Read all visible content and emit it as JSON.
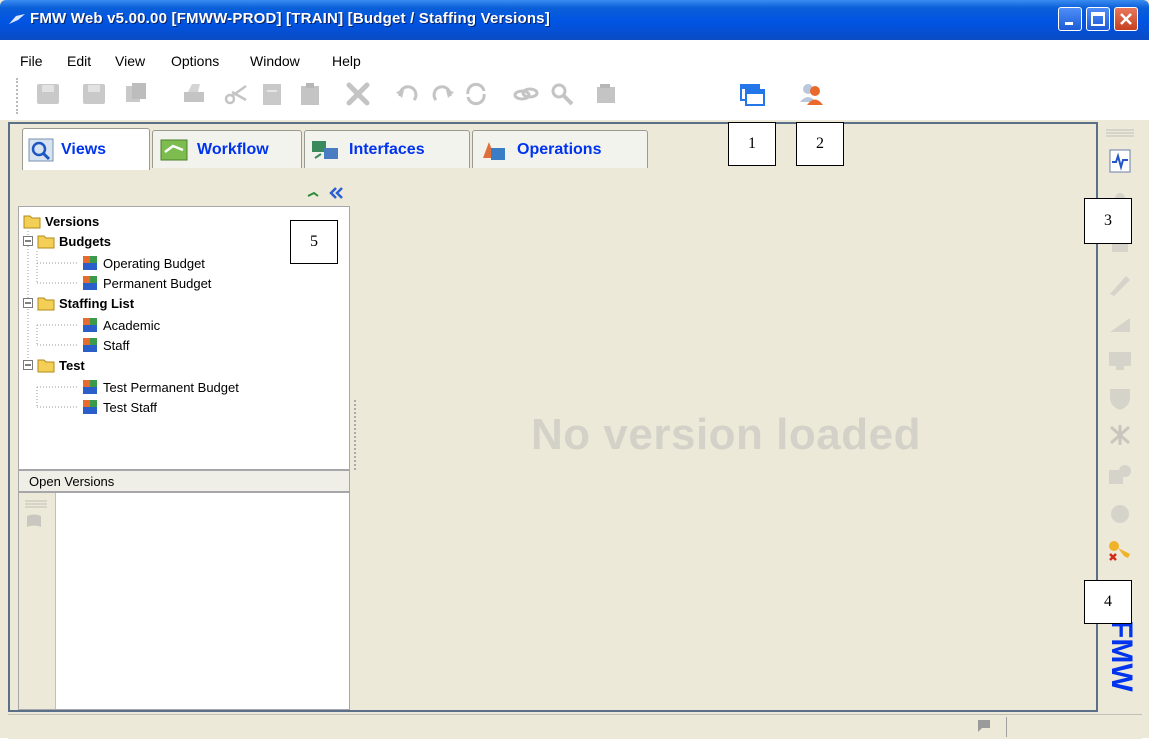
{
  "window": {
    "title": "FMW Web v5.00.00 [FMWW-PROD] [TRAIN] [Budget / Staffing Versions]",
    "title_bar_color": "#0054e3"
  },
  "menu": [
    "File",
    "Edit",
    "View",
    "Options",
    "Window",
    "Help"
  ],
  "toolbar": {
    "icons": [
      "save-all-icon",
      "save-icon",
      "copy-icon",
      "print-icon",
      "cut-icon",
      "paste-icon",
      "clipboard-icon",
      "delete-icon",
      "undo-icon",
      "redo-icon",
      "refresh-icon",
      "link-icon",
      "find-icon",
      "export-icon",
      "windows-icon",
      "user-icon"
    ]
  },
  "callouts": [
    "1",
    "2",
    "3",
    "4",
    "5"
  ],
  "tabs": [
    {
      "label": "Views",
      "icon": "views-icon",
      "active": true
    },
    {
      "label": "Workflow",
      "icon": "workflow-icon",
      "active": false
    },
    {
      "label": "Interfaces",
      "icon": "interfaces-icon",
      "active": false
    },
    {
      "label": "Operations",
      "icon": "operations-icon",
      "active": false
    }
  ],
  "tree": {
    "root": "Versions",
    "groups": [
      {
        "label": "Budgets",
        "children": [
          "Operating Budget",
          "Permanent Budget"
        ]
      },
      {
        "label": "Staffing List",
        "children": [
          "Academic",
          "Staff"
        ]
      },
      {
        "label": "Test",
        "children": [
          "Test Permanent Budget",
          "Test Staff"
        ]
      }
    ]
  },
  "open_versions_label": "Open Versions",
  "content": {
    "message": "No version loaded"
  },
  "watermark": "FMW",
  "colors": {
    "tab_label": "#0033ee",
    "message": "#d4d2c8",
    "frame_border": "#5b6f89"
  }
}
